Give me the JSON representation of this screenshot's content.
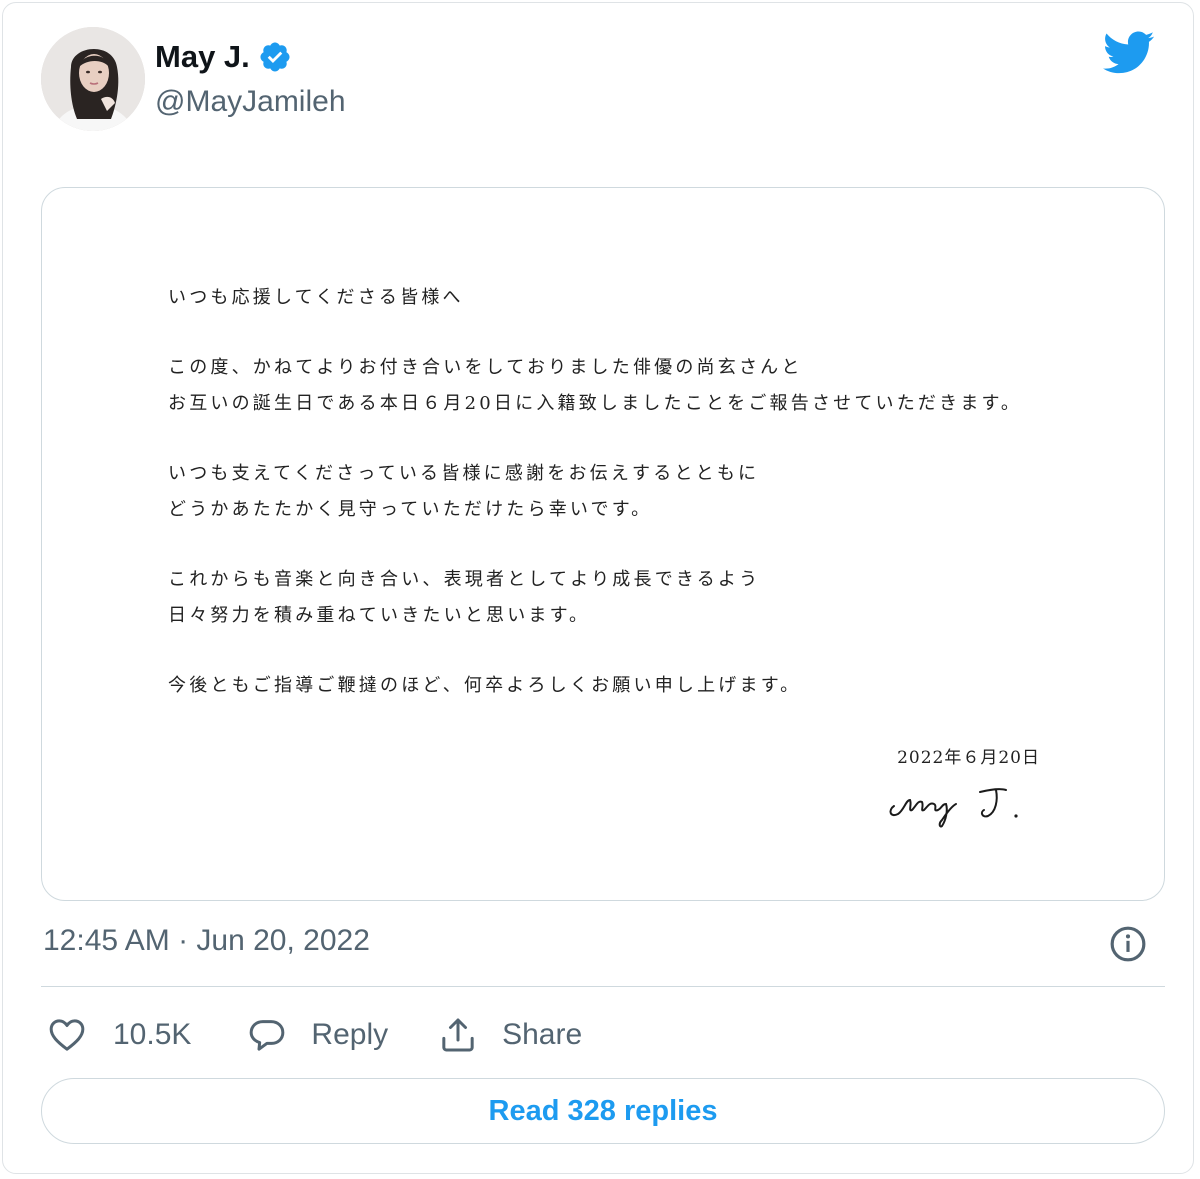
{
  "author": {
    "name": "May J.",
    "handle": "@MayJamileh",
    "verified": true
  },
  "letter": {
    "lines": [
      "いつも応援してくださる皆様へ",
      "",
      "この度、かねてよりお付き合いをしておりました俳優の尚玄さんと",
      "お互いの誕生日である本日６月20日に入籍致しましたことをご報告させていただきます。",
      "",
      "いつも支えてくださっている皆様に感謝をお伝えするとともに",
      "どうかあたたかく見守っていただけたら幸いです。",
      "",
      "これからも音楽と向き合い、表現者としてより成長できるよう",
      "日々努力を積み重ねていきたいと思います。",
      "",
      "今後ともご指導ご鞭撻のほど、何卒よろしくお願い申し上げます。"
    ],
    "date": "2022年６月20日",
    "signature": "May J."
  },
  "timestamp": "12:45 AM · Jun 20, 2022",
  "actions": {
    "like_count": "10.5K",
    "reply_label": "Reply",
    "share_label": "Share"
  },
  "read_replies_label": "Read 328 replies",
  "colors": {
    "brand": "#1d9bf0",
    "text": "#0f1419",
    "secondary_text": "#536471",
    "border": "#cfd9de"
  },
  "icons": {
    "logo": "twitter-bird-icon",
    "verified": "verified-badge-icon",
    "info": "info-icon",
    "like": "heart-icon",
    "reply": "speech-bubble-icon",
    "share": "share-upload-icon"
  }
}
